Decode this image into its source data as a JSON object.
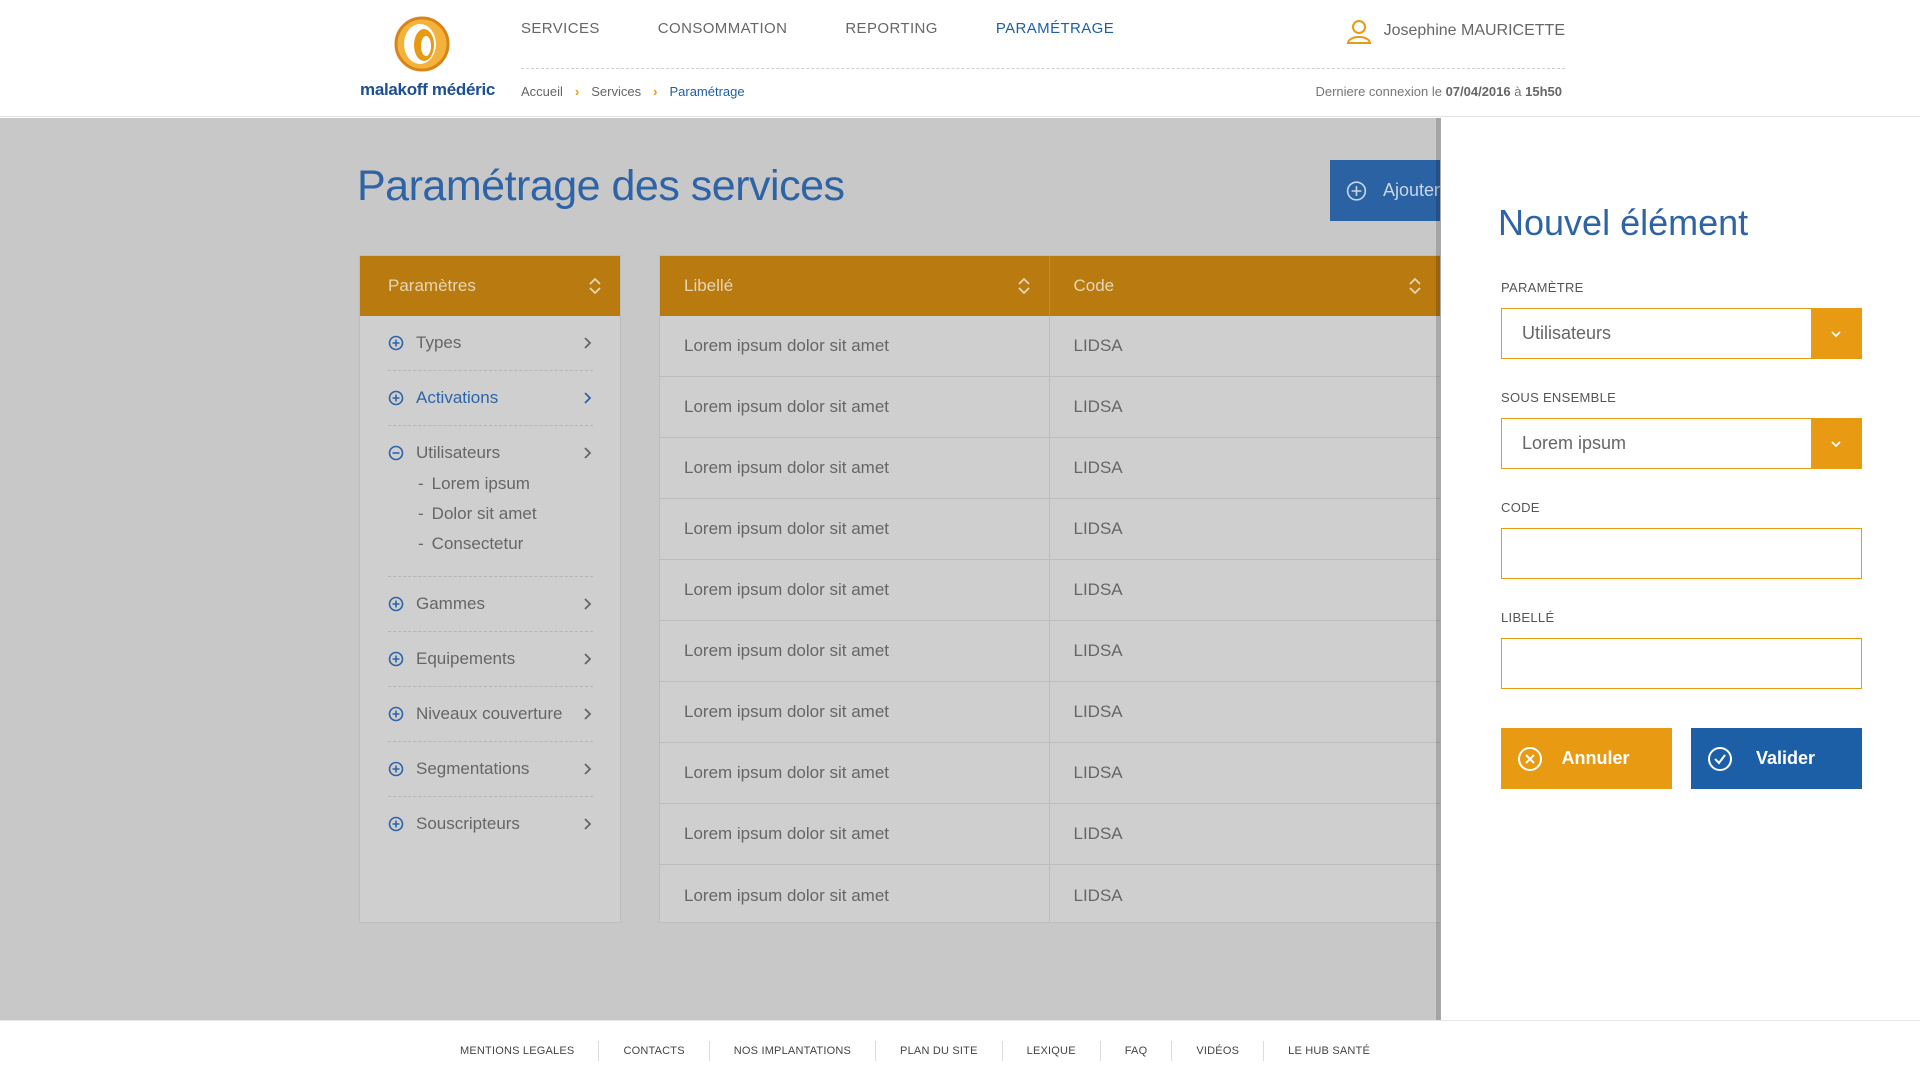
{
  "brand": {
    "name": "malakoff médéric",
    "colors": {
      "primary_blue": "#1d5fa6",
      "accent_orange": "#e79a12",
      "table_header": "#b97a10",
      "overlay": "#c8c8c9"
    }
  },
  "nav": {
    "items": [
      {
        "label": "SERVICES",
        "active": false
      },
      {
        "label": "CONSOMMATION",
        "active": false
      },
      {
        "label": "REPORTING",
        "active": false
      },
      {
        "label": "PARAMÉTRAGE",
        "active": true
      }
    ]
  },
  "user": {
    "name": "Josephine MAURICETTE",
    "icon": "user-icon"
  },
  "breadcrumb": {
    "items": [
      "Accueil",
      "Services",
      "Paramétrage"
    ]
  },
  "last_login": {
    "prefix": "Derniere connexion le",
    "date": "07/04/2016",
    "at": "à",
    "time": "15h50"
  },
  "page": {
    "title": "Paramétrage des services",
    "add_button": "Ajouter"
  },
  "params": {
    "header": "Paramètres",
    "items": [
      {
        "label": "Types",
        "state": "collapsed"
      },
      {
        "label": "Activations",
        "state": "collapsed",
        "active": true
      },
      {
        "label": "Utilisateurs",
        "state": "expanded",
        "children": [
          "Lorem ipsum",
          "Dolor sit amet",
          "Consectetur"
        ]
      },
      {
        "label": "Gammes",
        "state": "collapsed"
      },
      {
        "label": "Equipements",
        "state": "collapsed"
      },
      {
        "label": "Niveaux couverture",
        "state": "collapsed"
      },
      {
        "label": "Segmentations",
        "state": "collapsed"
      },
      {
        "label": "Souscripteurs",
        "state": "collapsed"
      }
    ]
  },
  "table": {
    "columns": [
      "Libellé",
      "Code"
    ],
    "rows": [
      [
        "Lorem ipsum dolor sit amet",
        "LIDSA"
      ],
      [
        "Lorem ipsum dolor sit amet",
        "LIDSA"
      ],
      [
        "Lorem ipsum dolor sit amet",
        "LIDSA"
      ],
      [
        "Lorem ipsum dolor sit amet",
        "LIDSA"
      ],
      [
        "Lorem ipsum dolor sit amet",
        "LIDSA"
      ],
      [
        "Lorem ipsum dolor sit amet",
        "LIDSA"
      ],
      [
        "Lorem ipsum dolor sit amet",
        "LIDSA"
      ],
      [
        "Lorem ipsum dolor sit amet",
        "LIDSA"
      ],
      [
        "Lorem ipsum dolor sit amet",
        "LIDSA"
      ],
      [
        "Lorem ipsum dolor sit amet",
        "LIDSA"
      ]
    ]
  },
  "drawer": {
    "title": "Nouvel élément",
    "parametre": {
      "label": "PARAMÈTRE",
      "value": "Utilisateurs"
    },
    "sous_ensemble": {
      "label": "SOUS ENSEMBLE",
      "value": "Lorem ipsum"
    },
    "code": {
      "label": "CODE",
      "value": ""
    },
    "libelle": {
      "label": "LIBELLÉ",
      "value": ""
    },
    "cancel_label": "Annuler",
    "validate_label": "Valider"
  },
  "footer": {
    "links": [
      "MENTIONS LEGALES",
      "CONTACTS",
      "NOS IMPLANTATIONS",
      "PLAN DU SITE",
      "LEXIQUE",
      "FAQ",
      "VIDÉOS",
      "LE HUB SANTÉ"
    ]
  }
}
